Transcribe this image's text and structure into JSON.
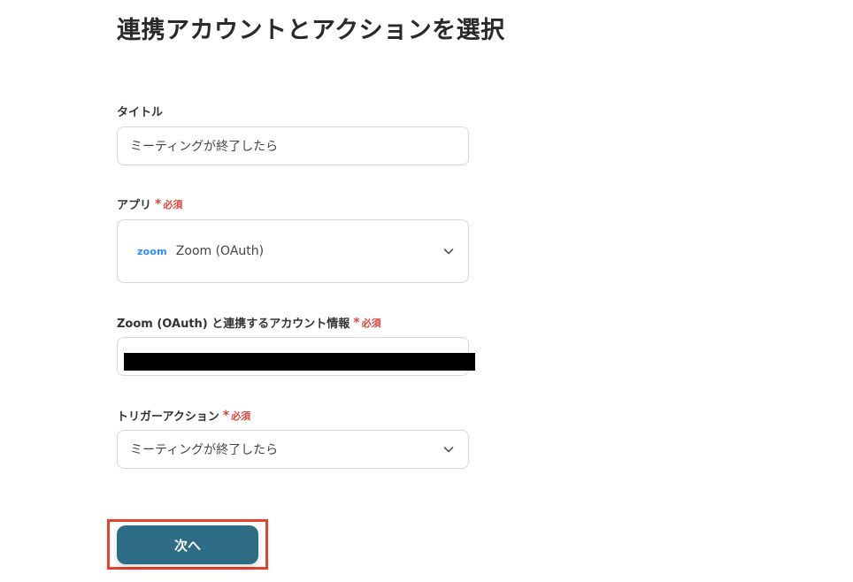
{
  "page": {
    "title": "連携アカウントとアクションを選択"
  },
  "required_label": "必須",
  "required_mark": "*",
  "fields": {
    "title": {
      "label": "タイトル",
      "value": "ミーティングが終了したら"
    },
    "app": {
      "label": "アプリ",
      "logo_text": "zoom",
      "value": "Zoom (OAuth)"
    },
    "account": {
      "label": "Zoom (OAuth) と連携するアカウント情報",
      "value_visible_fragment": "...",
      "redacted": true
    },
    "trigger": {
      "label": "トリガーアクション",
      "value": "ミーティングが終了したら"
    }
  },
  "actions": {
    "next_label": "次へ"
  },
  "colors": {
    "primary_button": "#2e6b85",
    "required": "#e0453a",
    "highlight": "#e8412c",
    "zoom_brand": "#2d8cff"
  }
}
